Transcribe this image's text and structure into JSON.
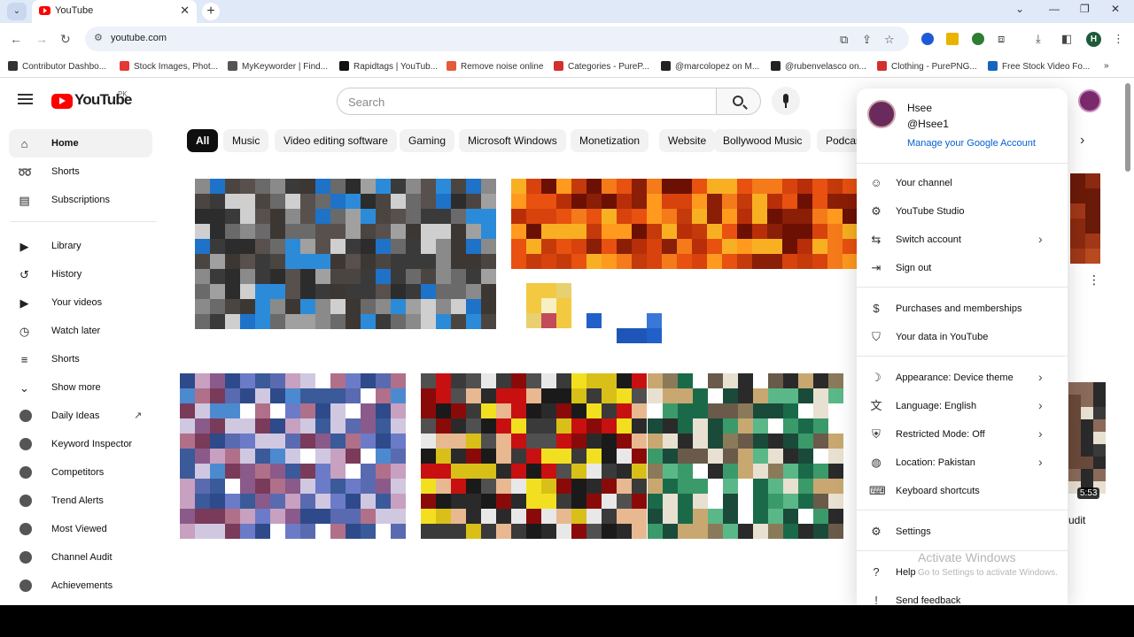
{
  "browser": {
    "tab_title": "YouTube",
    "tab_close": "✕",
    "new_tab": "+",
    "url": "youtube.com",
    "bookmarks": [
      {
        "label": "Contributor Dashbo...",
        "color": "#333333"
      },
      {
        "label": "Stock Images, Phot...",
        "color": "#e53935"
      },
      {
        "label": "MyKeyworder | Find...",
        "color": "#555555"
      },
      {
        "label": "Rapidtags | YouTub...",
        "color": "#111111"
      },
      {
        "label": "Remove noise online",
        "color": "#e35b3b"
      },
      {
        "label": "Categories - PureP...",
        "color": "#d32f2f"
      },
      {
        "label": "@marcolopez on M...",
        "color": "#222222"
      },
      {
        "label": "@rubenvelasco on...",
        "color": "#222222"
      },
      {
        "label": "Clothing - PurePNG...",
        "color": "#d32f2f"
      },
      {
        "label": "Free Stock Video Fo...",
        "color": "#1565c0"
      }
    ],
    "bookmarks_more": "»",
    "profile_initial": "H"
  },
  "header": {
    "logo_text": "YouTube",
    "country_code": "PK",
    "search_placeholder": "Search"
  },
  "chips": [
    "All",
    "Music",
    "Video editing software",
    "Gaming",
    "Microsoft Windows",
    "Monetization",
    "Website",
    "Bollywood Music",
    "Podcasts"
  ],
  "sidebar": {
    "main": [
      {
        "label": "Home",
        "icon": "home-icon",
        "glyph": "⌂"
      },
      {
        "label": "Shorts",
        "icon": "shorts-icon",
        "glyph": "➿"
      },
      {
        "label": "Subscriptions",
        "icon": "subscriptions-icon",
        "glyph": "▤"
      }
    ],
    "you": [
      {
        "label": "Library",
        "icon": "library-icon",
        "glyph": "▶"
      },
      {
        "label": "History",
        "icon": "history-icon",
        "glyph": "↺"
      },
      {
        "label": "Your videos",
        "icon": "your-videos-icon",
        "glyph": "▶"
      },
      {
        "label": "Watch later",
        "icon": "watch-later-icon",
        "glyph": "◷"
      },
      {
        "label": "Shorts",
        "icon": "shorts-list-icon",
        "glyph": "≡"
      },
      {
        "label": "Show more",
        "icon": "chevron-down-icon",
        "glyph": "⌄"
      }
    ],
    "extension": [
      {
        "label": "Daily Ideas"
      },
      {
        "label": "Keyword Inspector"
      },
      {
        "label": "Competitors"
      },
      {
        "label": "Trend Alerts"
      },
      {
        "label": "Most Viewed"
      },
      {
        "label": "Channel Audit"
      },
      {
        "label": "Achievements"
      }
    ]
  },
  "account_menu": {
    "name": "Hsee",
    "handle": "@Hsee1",
    "manage_link": "Manage your Google Account",
    "groups": [
      [
        {
          "label": "Your channel",
          "icon": "channel-icon",
          "glyph": "☺",
          "chevron": false
        },
        {
          "label": "YouTube Studio",
          "icon": "studio-icon",
          "glyph": "⚙",
          "chevron": false
        },
        {
          "label": "Switch account",
          "icon": "switch-account-icon",
          "glyph": "⇆",
          "chevron": true
        },
        {
          "label": "Sign out",
          "icon": "sign-out-icon",
          "glyph": "⇥",
          "chevron": false
        }
      ],
      [
        {
          "label": "Purchases and memberships",
          "icon": "dollar-icon",
          "glyph": "$",
          "chevron": false
        },
        {
          "label": "Your data in YouTube",
          "icon": "shield-user-icon",
          "glyph": "⛉",
          "chevron": false
        }
      ],
      [
        {
          "label": "Appearance: Device theme",
          "icon": "moon-icon",
          "glyph": "☽",
          "chevron": true
        },
        {
          "label": "Language: English",
          "icon": "translate-icon",
          "glyph": "文",
          "chevron": true
        },
        {
          "label": "Restricted Mode: Off",
          "icon": "restricted-icon",
          "glyph": "⛨",
          "chevron": true
        },
        {
          "label": "Location: Pakistan",
          "icon": "globe-icon",
          "glyph": "◍",
          "chevron": true
        },
        {
          "label": "Keyboard shortcuts",
          "icon": "keyboard-icon",
          "glyph": "⌨",
          "chevron": false
        }
      ],
      [
        {
          "label": "Settings",
          "icon": "gear-icon",
          "glyph": "⚙",
          "chevron": false
        }
      ],
      [
        {
          "label": "Help",
          "icon": "help-icon",
          "glyph": "?",
          "chevron": false
        },
        {
          "label": "Send feedback",
          "icon": "feedback-icon",
          "glyph": "!",
          "chevron": false
        }
      ]
    ]
  },
  "content": {
    "video_duration": "5:53",
    "partial_title": "udit"
  },
  "watermark": {
    "line1": "Activate Windows",
    "line2": "Go to Settings to activate Windows."
  }
}
